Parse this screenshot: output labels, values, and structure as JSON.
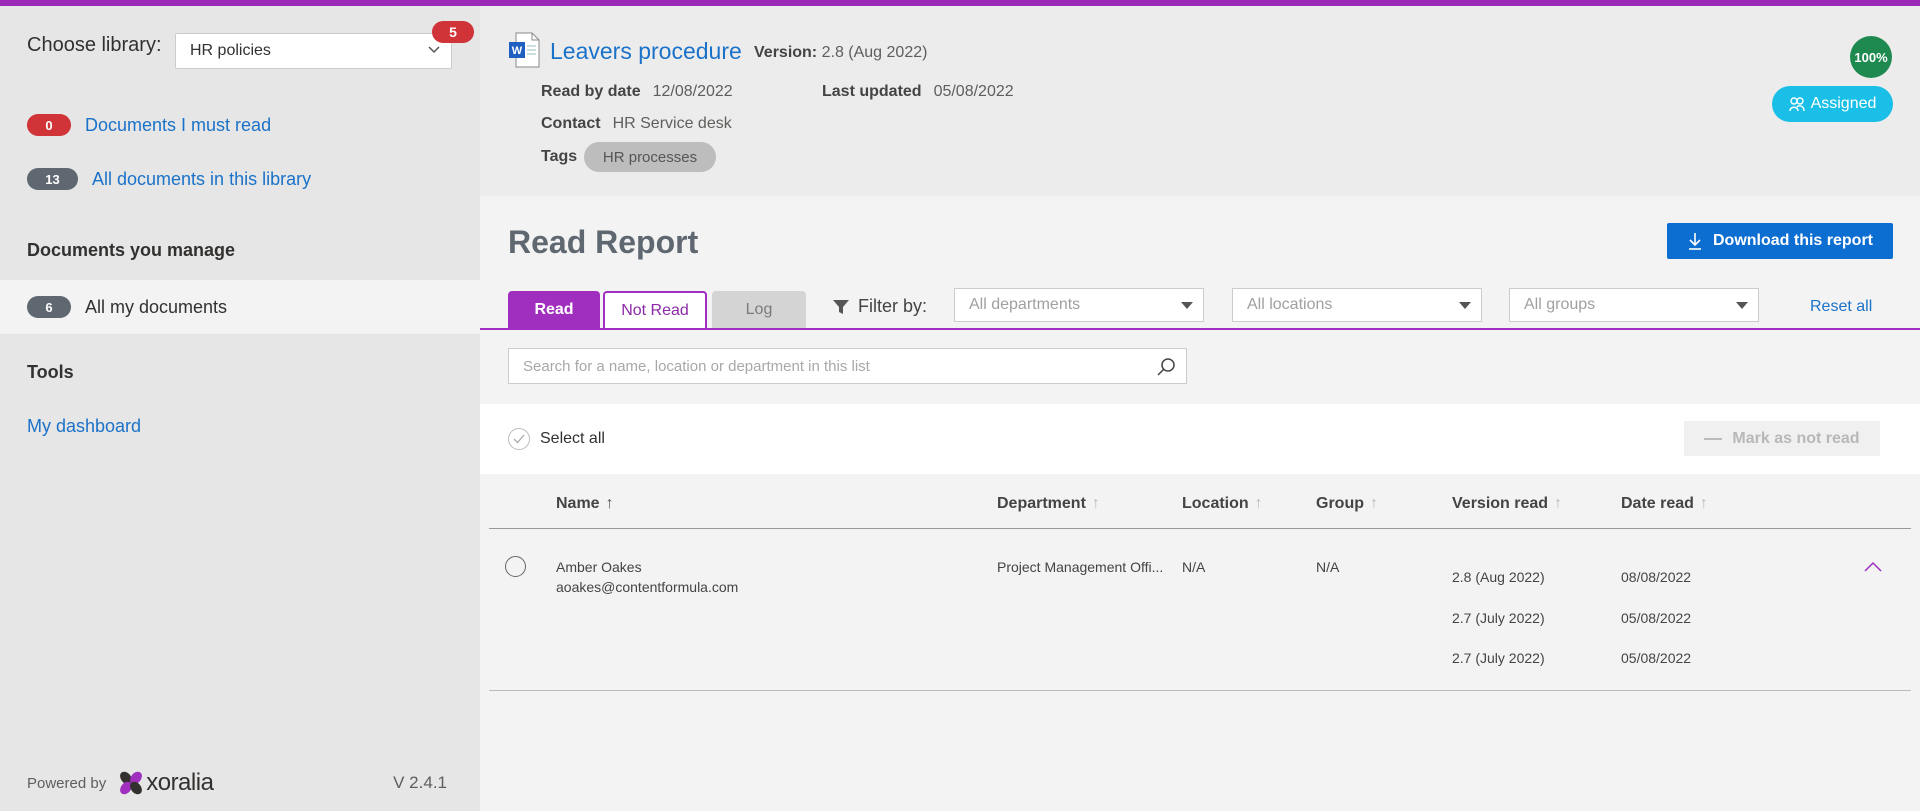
{
  "sidebar": {
    "library_label": "Choose library:",
    "library_value": "HR policies",
    "library_badge": "5",
    "must_read_count": "0",
    "must_read_label": "Documents I must read",
    "all_docs_count": "13",
    "all_docs_label": "All documents in this library",
    "manage_heading": "Documents you manage",
    "my_docs_count": "6",
    "my_docs_label": "All my documents",
    "tools_heading": "Tools",
    "dashboard_label": "My dashboard",
    "powered_by": "Powered by",
    "brand": "xoralia",
    "version": "V 2.4.1"
  },
  "document": {
    "title": "Leavers procedure",
    "version_label": "Version:",
    "version_value": "2.8 (Aug 2022)",
    "read_by_label": "Read by date",
    "read_by_value": "12/08/2022",
    "last_updated_label": "Last updated",
    "last_updated_value": "05/08/2022",
    "contact_label": "Contact",
    "contact_value": "HR Service desk",
    "tags_label": "Tags",
    "tag": "HR processes",
    "percent": "100%",
    "assigned_label": "Assigned"
  },
  "report": {
    "title": "Read Report",
    "download_label": "Download this report",
    "tabs": {
      "read": "Read",
      "not_read": "Not Read",
      "log": "Log"
    },
    "filter_label": "Filter by:",
    "filters": {
      "departments": "All departments",
      "locations": "All locations",
      "groups": "All groups"
    },
    "reset_label": "Reset all",
    "search_placeholder": "Search for a name, location or department in this list",
    "select_all_label": "Select all",
    "mark_not_read_label": "Mark as not read",
    "columns": {
      "name": "Name",
      "department": "Department",
      "location": "Location",
      "group": "Group",
      "version_read": "Version read",
      "date_read": "Date read"
    },
    "rows": [
      {
        "name": "Amber Oakes",
        "email": "aoakes@contentformula.com",
        "department": "Project Management Offi...",
        "location": "N/A",
        "group": "N/A",
        "versions": [
          "2.8 (Aug 2022)",
          "2.7 (July 2022)",
          "2.7 (July 2022)"
        ],
        "dates": [
          "08/08/2022",
          "05/08/2022",
          "05/08/2022"
        ]
      }
    ]
  },
  "colors": {
    "accent": "#a02fc0",
    "link": "#1b72c9",
    "primary_button": "#0c6ed1",
    "assigned": "#19bfe6",
    "complete": "#1e8a4f",
    "alert": "#d13438"
  }
}
